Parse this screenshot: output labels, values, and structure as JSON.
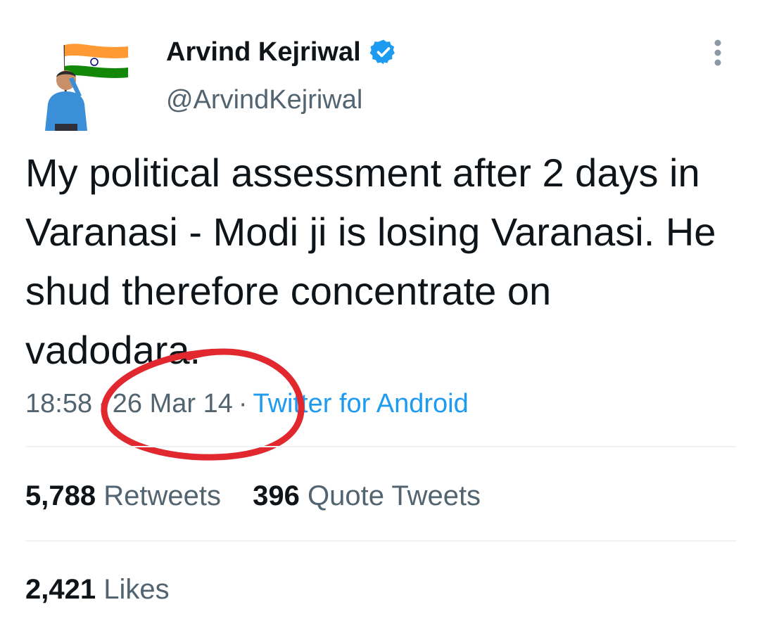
{
  "author": {
    "display_name": "Arvind Kejriwal",
    "handle": "@ArvindKejriwal",
    "avatar_icon": "profile-avatar-with-indian-flag",
    "verified_icon": "verified-badge-icon",
    "verified_color": "#1d9bf0"
  },
  "tweet": {
    "text": "My political assessment after 2 days in Varanasi - Modi ji is losing Varanasi. He shud therefore concentrate on vadodara.",
    "time": "18:58",
    "separator": "·",
    "date": "26 Mar 14",
    "source": "Twitter for Android"
  },
  "stats": {
    "retweets_count": "5,788",
    "retweets_label": "Retweets",
    "quote_tweets_count": "396",
    "quote_tweets_label": "Quote Tweets",
    "likes_count": "2,421",
    "likes_label": "Likes"
  },
  "annotation": {
    "shape": "red-ellipse-around-date",
    "color": "#e0282e"
  }
}
